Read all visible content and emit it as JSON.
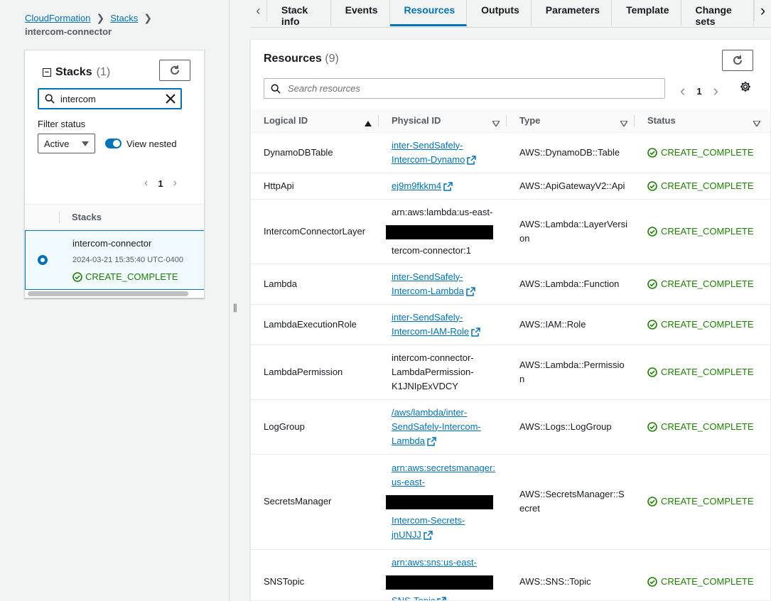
{
  "breadcrumb": {
    "root": "CloudFormation",
    "stacks": "Stacks",
    "current": "intercom-connector"
  },
  "stacks_panel": {
    "title": "Stacks",
    "count": "(1)",
    "search_value": "intercom",
    "filter_label": "Filter status",
    "filter_value": "Active",
    "view_nested_label": "View nested",
    "page": "1",
    "column_header": "Stacks",
    "rows": [
      {
        "name": "intercom-connector",
        "time": "2024-03-21 15:35:40 UTC-0400",
        "status": "CREATE_COMPLETE"
      }
    ]
  },
  "tabs": [
    "Stack info",
    "Events",
    "Resources",
    "Outputs",
    "Parameters",
    "Template",
    "Change sets"
  ],
  "resources": {
    "title": "Resources",
    "count": "(9)",
    "search_placeholder": "Search resources",
    "page": "1",
    "columns": [
      "Logical ID",
      "Physical ID",
      "Type",
      "Status"
    ],
    "rows": [
      {
        "logical": "DynamoDBTable",
        "physical": [
          "inter-SendSafely-",
          "Intercom-Dynamo"
        ],
        "link": true,
        "type": [
          "AWS::DynamoDB::Table"
        ],
        "status": "CREATE_COMPLETE"
      },
      {
        "logical": "HttpApi",
        "physical": [
          "ej9m9fkkm4"
        ],
        "link": true,
        "type": [
          "AWS::ApiGatewayV2::Api"
        ],
        "status": "CREATE_COMPLETE"
      },
      {
        "logical": "IntercomConnectorLayer",
        "physical": [
          "arn:aws:lambda:us-east-",
          "",
          "tercom-connector:1"
        ],
        "link": false,
        "type": [
          "AWS::Lambda::LayerVersi",
          "on"
        ],
        "status": "CREATE_COMPLETE"
      },
      {
        "logical": "Lambda",
        "physical": [
          "inter-SendSafely-",
          "Intercom-Lambda"
        ],
        "link": true,
        "type": [
          "AWS::Lambda::Function"
        ],
        "status": "CREATE_COMPLETE"
      },
      {
        "logical": "LambdaExecutionRole",
        "physical": [
          "inter-SendSafely-",
          "Intercom-IAM-Role"
        ],
        "link": true,
        "type": [
          "AWS::IAM::Role"
        ],
        "status": "CREATE_COMPLETE"
      },
      {
        "logical": "LambdaPermission",
        "physical": [
          "intercom-connector-",
          "LambdaPermission-",
          "K1JNIpExVDCY"
        ],
        "link": false,
        "type": [
          "AWS::Lambda::Permissio",
          "n"
        ],
        "status": "CREATE_COMPLETE"
      },
      {
        "logical": "LogGroup",
        "physical": [
          "/aws/lambda/inter-",
          "SendSafely-Intercom-",
          "Lambda"
        ],
        "link": true,
        "type": [
          "AWS::Logs::LogGroup"
        ],
        "status": "CREATE_COMPLETE"
      },
      {
        "logical": "SecretsManager",
        "physical": [
          "arn:aws:secretsmanager:",
          "us-east-",
          "",
          "Intercom-Secrets-",
          "jnUNJJ"
        ],
        "link": true,
        "type": [
          "AWS::SecretsManager::S",
          "ecret"
        ],
        "status": "CREATE_COMPLETE"
      },
      {
        "logical": "SNSTopic",
        "physical": [
          "arn:aws:sns:us-east-",
          "",
          "SNS-Topic"
        ],
        "link": true,
        "type": [
          "AWS::SNS::Topic"
        ],
        "status": "CREATE_COMPLETE"
      }
    ]
  },
  "colors": {
    "link": "#0073bb",
    "success": "#1d8102",
    "text": "#16191f"
  }
}
